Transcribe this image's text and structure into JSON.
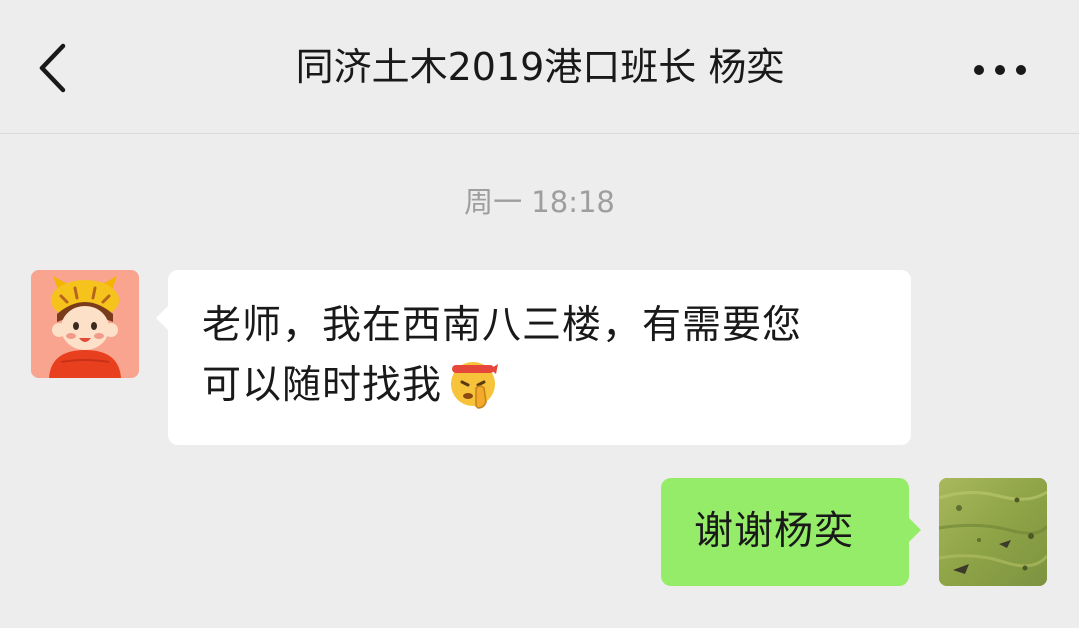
{
  "header": {
    "title": "同济土木2019港口班长 杨奕",
    "back_icon": "chevron-left-icon",
    "more_icon": "more-dots-icon"
  },
  "chat": {
    "time_label": "周一 18:18",
    "messages": [
      {
        "direction": "incoming",
        "avatar_icon": "cartoon-tiger-hat-avatar",
        "line1": "老师，我在西南八三楼，有需要您",
        "line2": "可以随时找我",
        "emoji_icon": "saluting-emoji-icon"
      },
      {
        "direction": "outgoing",
        "avatar_icon": "grass-photo-avatar",
        "text": "谢谢杨奕"
      }
    ]
  },
  "colors": {
    "background": "#EDEDED",
    "incoming_bubble": "#FFFFFF",
    "outgoing_bubble": "#95EC69",
    "timestamp_text": "#9E9E9E"
  }
}
